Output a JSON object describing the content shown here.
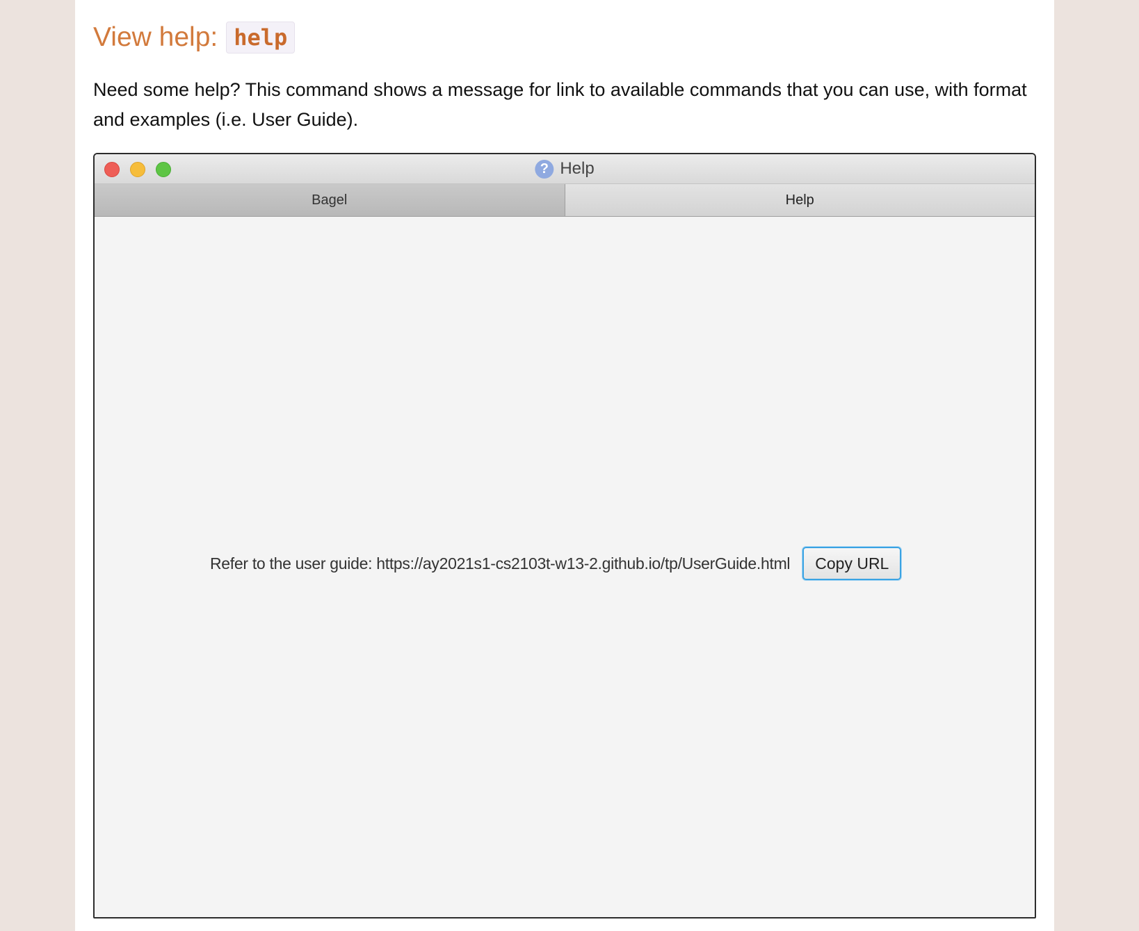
{
  "doc": {
    "heading_text": "View help:",
    "heading_code": "help",
    "intro": "Need some help? This command shows a message for link to available commands that you can use, with format and examples (i.e. User Guide)."
  },
  "window": {
    "title": "Help",
    "title_icon": "question-circle-icon",
    "controls": [
      "close",
      "minimize",
      "maximize"
    ],
    "tabs": [
      {
        "label": "Bagel",
        "selected": false
      },
      {
        "label": "Help",
        "selected": true
      }
    ],
    "guide_text": "Refer to the user guide: https://ay2021s1-cs2103t-w13-2.github.io/tp/UserGuide.html",
    "copy_button": "Copy URL"
  },
  "colors": {
    "heading": "#d27a3c",
    "page_background": "#ece3de",
    "button_focus": "#3aa3e3"
  }
}
